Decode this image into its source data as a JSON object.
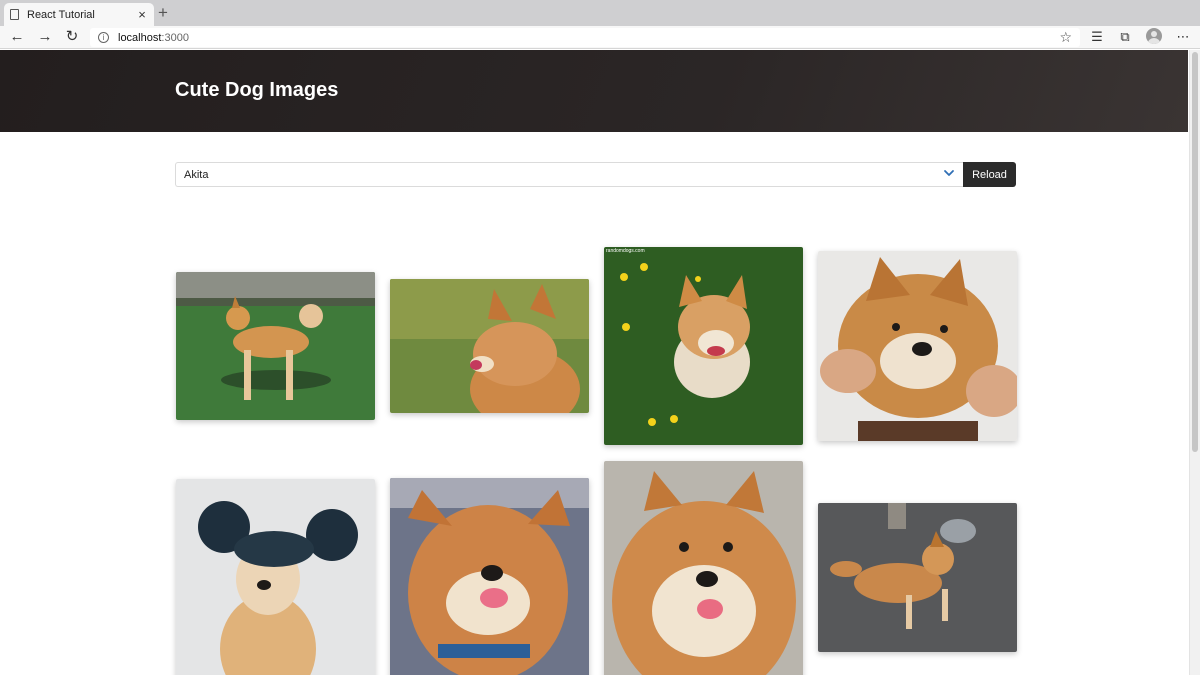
{
  "browser": {
    "tab_title": "React Tutorial",
    "tab_close_glyph": "×",
    "new_tab_glyph": "+",
    "url_host": "localhost",
    "url_port": ":3000",
    "icons": [
      "back-icon",
      "forward-icon",
      "refresh-icon",
      "info-icon",
      "star-icon",
      "favorites-icon",
      "collections-icon",
      "profile-icon",
      "more-icon"
    ]
  },
  "page": {
    "title": "Cute Dog Images",
    "breed_select": {
      "selected": "Akita"
    },
    "reload_label": "Reload"
  },
  "images": [
    {
      "alt": "Shiba standing on grass field"
    },
    {
      "alt": "Shiba licking nose profile"
    },
    {
      "alt": "Shiba sitting in grass with dandelions",
      "watermark": "randomdogs.com"
    },
    {
      "alt": "Shiba face squished by hands"
    },
    {
      "alt": "Shiba wearing mouse ears hat"
    },
    {
      "alt": "Shiba close-up with tongue out"
    },
    {
      "alt": "Shiba smiling portrait"
    },
    {
      "alt": "Shiba lying on gravel"
    }
  ],
  "colors": {
    "hero_bg": "#231e1e",
    "button_bg": "#2b2b2b",
    "select_chevron": "#2f6fb5"
  }
}
